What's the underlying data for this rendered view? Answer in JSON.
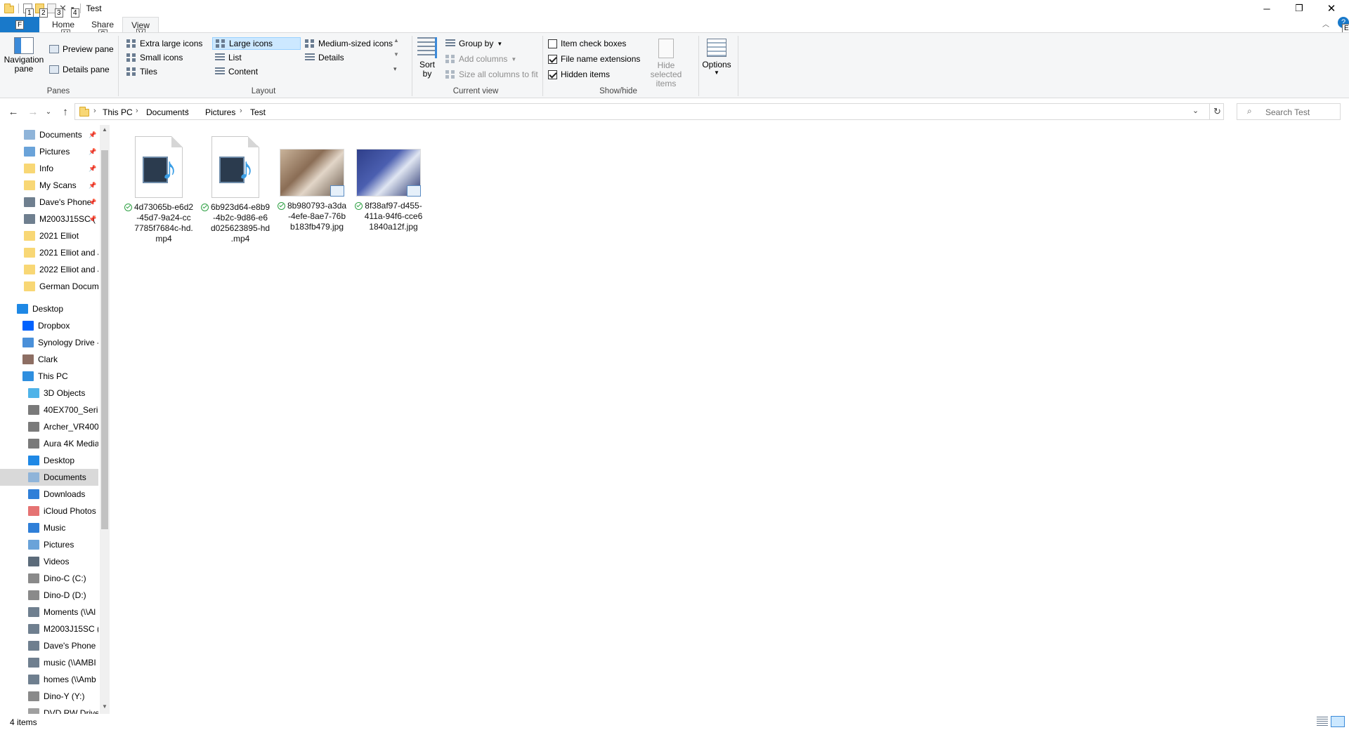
{
  "window": {
    "title": "Test",
    "keytips": [
      "1",
      "2",
      "3",
      "4"
    ]
  },
  "tabs": {
    "file": {
      "label": "File",
      "keytip": "F"
    },
    "home": {
      "label": "Home",
      "keytip": "H"
    },
    "share": {
      "label": "Share",
      "keytip": "S"
    },
    "view": {
      "label": "View",
      "keytip": "V"
    },
    "help_keytip": "E"
  },
  "ribbon": {
    "panes": {
      "label": "Panes",
      "navigation_pane": "Navigation pane",
      "preview_pane": "Preview pane",
      "details_pane": "Details pane"
    },
    "layout": {
      "label": "Layout",
      "items": [
        "Extra large icons",
        "Large icons",
        "Medium-sized icons",
        "Small icons",
        "List",
        "Details",
        "Tiles",
        "Content"
      ],
      "selected": "Large icons"
    },
    "current_view": {
      "label": "Current view",
      "sort_by": "Sort by",
      "group_by": "Group by",
      "add_columns": "Add columns",
      "size_all_columns": "Size all columns to fit"
    },
    "show_hide": {
      "label": "Show/hide",
      "item_check_boxes": "Item check boxes",
      "item_check_boxes_checked": false,
      "file_name_extensions": "File name extensions",
      "file_name_extensions_checked": true,
      "hidden_items": "Hidden items",
      "hidden_items_checked": true,
      "hide_selected_items": "Hide selected items"
    },
    "options": "Options"
  },
  "address": {
    "breadcrumbs": [
      "This PC",
      "Documents",
      "Pictures",
      "Test"
    ],
    "search_placeholder": "Search Test"
  },
  "nav": {
    "quick_access": [
      {
        "label": "Documents",
        "icon": "documents-icon",
        "pinned": true
      },
      {
        "label": "Pictures",
        "icon": "pictures-icon",
        "pinned": true
      },
      {
        "label": "Info",
        "icon": "folder-icon",
        "pinned": true
      },
      {
        "label": "My Scans",
        "icon": "folder-icon",
        "pinned": true
      },
      {
        "label": "Dave's Phone",
        "icon": "network-drive-icon",
        "pinned": true
      },
      {
        "label": "M2003J15SC (",
        "icon": "network-drive-icon",
        "pinned": true
      },
      {
        "label": "2021 Elliot",
        "icon": "folder-icon",
        "pinned": false
      },
      {
        "label": "2021 Elliot and Je",
        "icon": "folder-icon",
        "pinned": false
      },
      {
        "label": "2022 Elliot and Je",
        "icon": "folder-icon",
        "pinned": false
      },
      {
        "label": "German Docume",
        "icon": "folder-icon",
        "pinned": false
      }
    ],
    "roots": [
      {
        "label": "Desktop",
        "icon": "desktop-icon"
      },
      {
        "label": "Dropbox",
        "icon": "dropbox-icon"
      },
      {
        "label": "Synology Drive -",
        "icon": "synology-icon"
      },
      {
        "label": "Clark",
        "icon": "user-icon"
      },
      {
        "label": "This PC",
        "icon": "computer-icon"
      }
    ],
    "this_pc": [
      {
        "label": "3D Objects",
        "icon": "3d-objects-icon"
      },
      {
        "label": "40EX700_Series",
        "icon": "media-device-icon"
      },
      {
        "label": "Archer_VR400",
        "icon": "media-device-icon"
      },
      {
        "label": "Aura 4K Media",
        "icon": "media-device-icon"
      },
      {
        "label": "Desktop",
        "icon": "desktop-icon"
      },
      {
        "label": "Documents",
        "icon": "documents-icon",
        "selected": true
      },
      {
        "label": "Downloads",
        "icon": "downloads-icon"
      },
      {
        "label": "iCloud Photos",
        "icon": "icloud-icon"
      },
      {
        "label": "Music",
        "icon": "music-icon"
      },
      {
        "label": "Pictures",
        "icon": "pictures-icon"
      },
      {
        "label": "Videos",
        "icon": "videos-icon"
      },
      {
        "label": "Dino-C (C:)",
        "icon": "drive-icon"
      },
      {
        "label": "Dino-D (D:)",
        "icon": "drive-icon"
      },
      {
        "label": "Moments (\\\\Al",
        "icon": "network-drive-icon"
      },
      {
        "label": "M2003J15SC (\\",
        "icon": "network-drive-icon"
      },
      {
        "label": "Dave's Phone (",
        "icon": "network-drive-icon"
      },
      {
        "label": "music (\\\\AMBI",
        "icon": "network-drive-icon"
      },
      {
        "label": "homes (\\\\Amb",
        "icon": "network-drive-icon"
      },
      {
        "label": "Dino-Y (Y:)",
        "icon": "drive-icon"
      },
      {
        "label": "DVD RW Drive",
        "icon": "dvd-drive-icon"
      }
    ]
  },
  "files": [
    {
      "name": "4d73065b-e6d2-45d7-9a24-cc7785f7684c-hd.mp4",
      "lines": [
        "4d73065b-e6d2",
        "-45d7-9a24-cc",
        "7785f7684c-hd.",
        "mp4"
      ],
      "type": "video"
    },
    {
      "name": "6b923d64-e8b9-4b2c-9d86-e6d025623895-hd.mp4",
      "lines": [
        "6b923d64-e8b9",
        "-4b2c-9d86-e6",
        "d025623895-hd",
        ".mp4"
      ],
      "type": "video"
    },
    {
      "name": "8b980793-a3da-4efe-8ae7-76bb183fb479.jpg",
      "lines": [
        "8b980793-a3da",
        "-4efe-8ae7-76b",
        "b183fb479.jpg"
      ],
      "type": "image"
    },
    {
      "name": "8f38af97-d455-411a-94f6-cce61840a12f.jpg",
      "lines": [
        "8f38af97-d455-",
        "411a-94f6-cce6",
        "1840a12f.jpg"
      ],
      "type": "image"
    }
  ],
  "status": {
    "item_count": "4 items"
  }
}
